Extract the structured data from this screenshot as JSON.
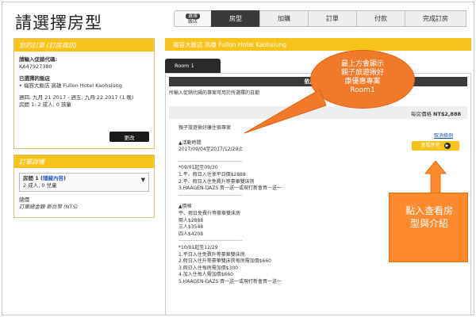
{
  "page_title": "請選擇房型",
  "steps": [
    {
      "label_top": "選擇",
      "label_bottom": "飯店"
    },
    {
      "label": "房型"
    },
    {
      "label": "加購"
    },
    {
      "label": "訂單"
    },
    {
      "label": "付款"
    },
    {
      "label": "完成訂房"
    }
  ],
  "order": {
    "header_prefix": "您的訂單 ",
    "header_em": "(訂房資訊)",
    "promo_label": "請輸入促銷代碼:",
    "promo_value": "KA47927380",
    "hotel_label": "已選擇的飯店",
    "hotel_value": "• 福容大飯店 高雄 Fullon Hotel Kaohsiung",
    "dates": "週四, 九月 21 2017 - 週五, 九月 22 2017 (1 晚)",
    "guests": "房間 1: 2 成人, 0 孩童",
    "change_button": "更改"
  },
  "details": {
    "header": "訂單詳情",
    "room_line_prefix": "房間 1 (",
    "room_line_link": "隱藏內容",
    "room_line_suffix": ")",
    "room_guests": "2 成人, 0 兒童",
    "total_label": "總價",
    "total_note": "訂單總金額 新台幣 (NTS)"
  },
  "main": {
    "hotel_name": "福容大飯店 高雄 Fullon Hotel Kaohsiung",
    "room_tab": "Room 1",
    "sort_title": "依房價顯示",
    "sort_note": "所輸入促銷代碼的專案可用於所選擇的日期",
    "price_label": "每房價格",
    "price_value": "NT$2,888",
    "plan_name": "親子旅遊揪好康住宿專案",
    "cancel_link": "取消條例",
    "view_button": "查看房型",
    "plan_lines": [
      "▲活動時間",
      "2017/09/04至2017/12/29止",
      "",
      "-------------------------------------",
      "*09/01起至09/30",
      "1.平、假日入住享平日價$2888",
      "2.平、假日入住免費升等豪華雙床房",
      "3.HAAGEN-DAZS 買一送一或現打新會買一送一",
      "-------------------------------------",
      "",
      "▲價格",
      "平、假日免費升等豪華雙床房",
      "兩人$2888",
      "三人$3548",
      "四人$4208",
      "-------------------------------------",
      "*10/01起至12/29",
      "1.平日入住免費升等豪華雙床房",
      "2.假日入住升等豪華雙床房每房需加價$660",
      "3.假日入住每房需加價$300",
      "4.加入住每人需加價$660",
      "5.HAAGEN-DAZS 買一送一或現打新會買一送一"
    ]
  },
  "callouts": {
    "top": [
      "最上方會顯示",
      "親子旅遊揪好",
      "康優惠專案",
      "Room1"
    ],
    "bottom": [
      "點入查看房",
      "型與介紹"
    ]
  },
  "colors": {
    "accent": "#f7c21a",
    "callout": "#f07a2a",
    "dark": "#3a3a3a"
  }
}
